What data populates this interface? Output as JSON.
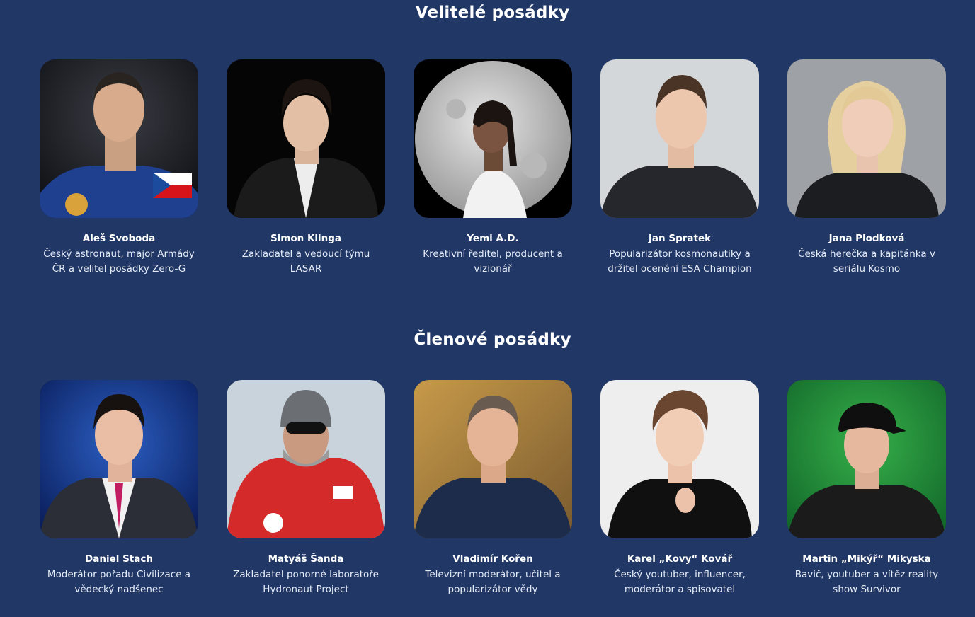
{
  "sections": [
    {
      "title": "Velitelé posádky",
      "members": [
        {
          "name": "Aleš Svoboda",
          "desc": "Český astronaut, major Armády ČR a velitel posádky Zero-G",
          "photo": "astronaut-portrait"
        },
        {
          "name": "Simon Klinga",
          "desc": "Zakladatel a vedoucí týmu LASAR",
          "photo": "young-man-portrait"
        },
        {
          "name": "Yemi A.D.",
          "desc": "Kreativní ředitel, producent a vizionář",
          "photo": "man-moon-portrait"
        },
        {
          "name": "Jan Spratek",
          "desc": "Popularizátor kosmonautiky a držitel ocenění ESA Champion",
          "photo": "man-grey-portrait"
        },
        {
          "name": "Jana Plodková",
          "desc": "Česká herečka a kapitánka v seriálu Kosmo",
          "photo": "woman-blonde-portrait"
        }
      ]
    },
    {
      "title": "Členové posádky",
      "members": [
        {
          "name": "Daniel Stach",
          "desc": "Moderátor pořadu Civilizace a vědecký nadšenec",
          "photo": "tv-host-portrait"
        },
        {
          "name": "Matyáš Šanda",
          "desc": "Zakladatel ponorné laboratoře Hydronaut Project",
          "photo": "polar-explorer-portrait"
        },
        {
          "name": "Vladimír Kořen",
          "desc": "Televizní moderátor, učitel a popularizátor vědy",
          "photo": "smiling-man-autumn-portrait"
        },
        {
          "name": "Karel „Kovy“ Kovář",
          "desc": "Český youtuber, influencer, moderátor a spisovatel",
          "photo": "youtuber-portrait"
        },
        {
          "name": "Martin „Mikýř“ Mikyska",
          "desc": "Bavič, youtuber a vítěz reality show Survivor",
          "photo": "man-cap-green-portrait"
        }
      ]
    }
  ],
  "colors": {
    "background": "#213766",
    "text": "#ffffff"
  }
}
